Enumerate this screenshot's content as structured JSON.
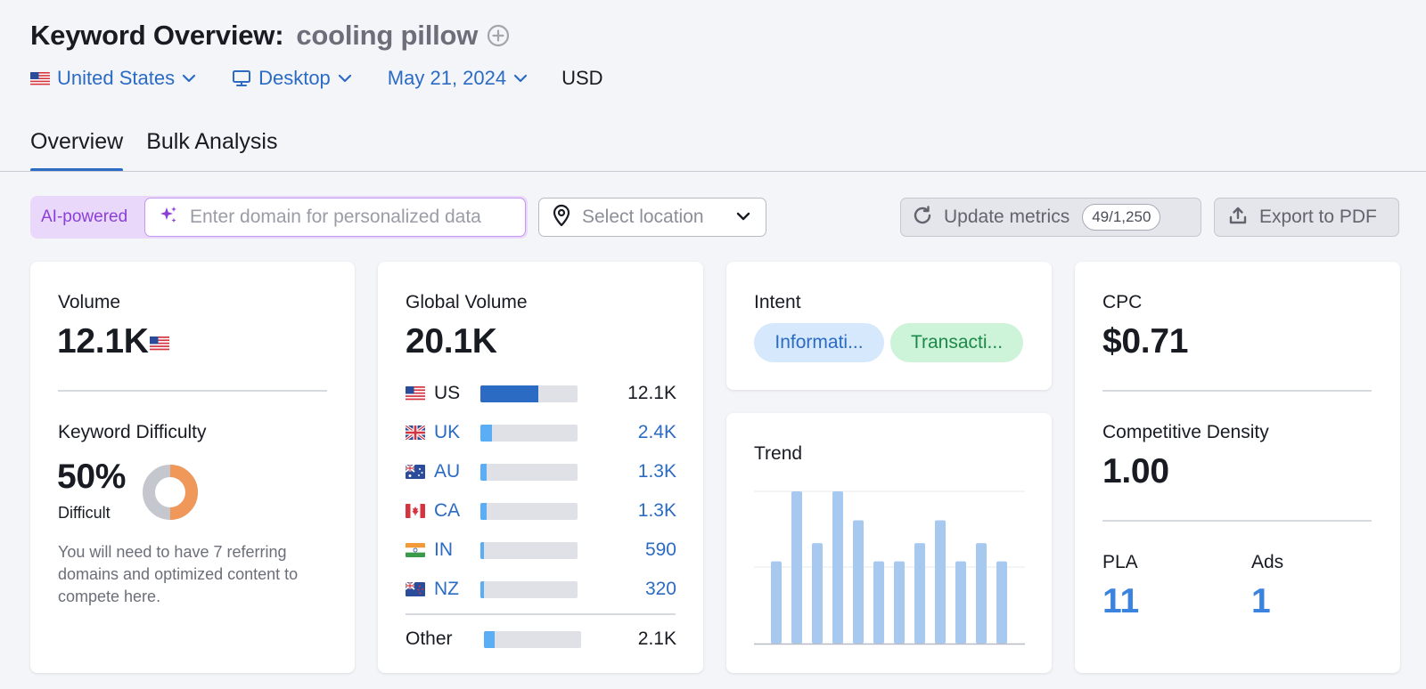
{
  "header": {
    "title": "Keyword Overview:",
    "keyword": "cooling pillow",
    "add_icon": "plus-circle-icon"
  },
  "filters": {
    "country": "United States",
    "device": "Desktop",
    "date": "May 21, 2024",
    "currency": "USD"
  },
  "tabs": [
    {
      "label": "Overview",
      "active": true
    },
    {
      "label": "Bulk Analysis",
      "active": false
    }
  ],
  "toolbar": {
    "ai_label": "AI-powered",
    "domain_placeholder": "Enter domain for personalized data",
    "location_placeholder": "Select location",
    "update_label": "Update metrics",
    "update_count": "49/1,250",
    "export_label": "Export to PDF"
  },
  "volume_card": {
    "volume_label": "Volume",
    "volume_value": "12.1K",
    "kd_label": "Keyword Difficulty",
    "kd_value": "50%",
    "kd_level": "Difficult",
    "kd_fraction": 0.5,
    "kd_note": "You will need to have 7 referring domains and optimized content to compete here."
  },
  "global_card": {
    "label": "Global Volume",
    "value": "20.1K",
    "countries": [
      {
        "code": "US",
        "value": "12.1K",
        "share": 0.6,
        "link": false
      },
      {
        "code": "UK",
        "value": "2.4K",
        "share": 0.12,
        "link": true
      },
      {
        "code": "AU",
        "value": "1.3K",
        "share": 0.065,
        "link": true
      },
      {
        "code": "CA",
        "value": "1.3K",
        "share": 0.065,
        "link": true
      },
      {
        "code": "IN",
        "value": "590",
        "share": 0.04,
        "link": true
      },
      {
        "code": "NZ",
        "value": "320",
        "share": 0.03,
        "link": true
      }
    ],
    "other": {
      "label": "Other",
      "value": "2.1K",
      "share": 0.11
    }
  },
  "intent_card": {
    "label": "Intent",
    "intents": [
      {
        "label": "Informati...",
        "bg": "#d6e8fc",
        "color": "#2b6bc4"
      },
      {
        "label": "Transacti...",
        "bg": "#cdf3d8",
        "color": "#1c8a4a"
      }
    ]
  },
  "trend_card": {
    "label": "Trend",
    "bar_color": "#a7c9f0",
    "values": [
      0.54,
      1.0,
      0.66,
      1.0,
      0.81,
      0.54,
      0.54,
      0.66,
      0.81,
      0.54,
      0.66,
      0.54
    ]
  },
  "cpc_card": {
    "cpc_label": "CPC",
    "cpc_value": "$0.71",
    "density_label": "Competitive Density",
    "density_value": "1.00",
    "pla_label": "PLA",
    "pla_value": "11",
    "ads_label": "Ads",
    "ads_value": "1"
  },
  "colors": {
    "accent": "#2b6bc4",
    "bar_us": "#2b6bc4",
    "bar_other": "#5aaef5",
    "kd_orange": "#f0975a",
    "kd_gray": "#c5c7ce"
  }
}
